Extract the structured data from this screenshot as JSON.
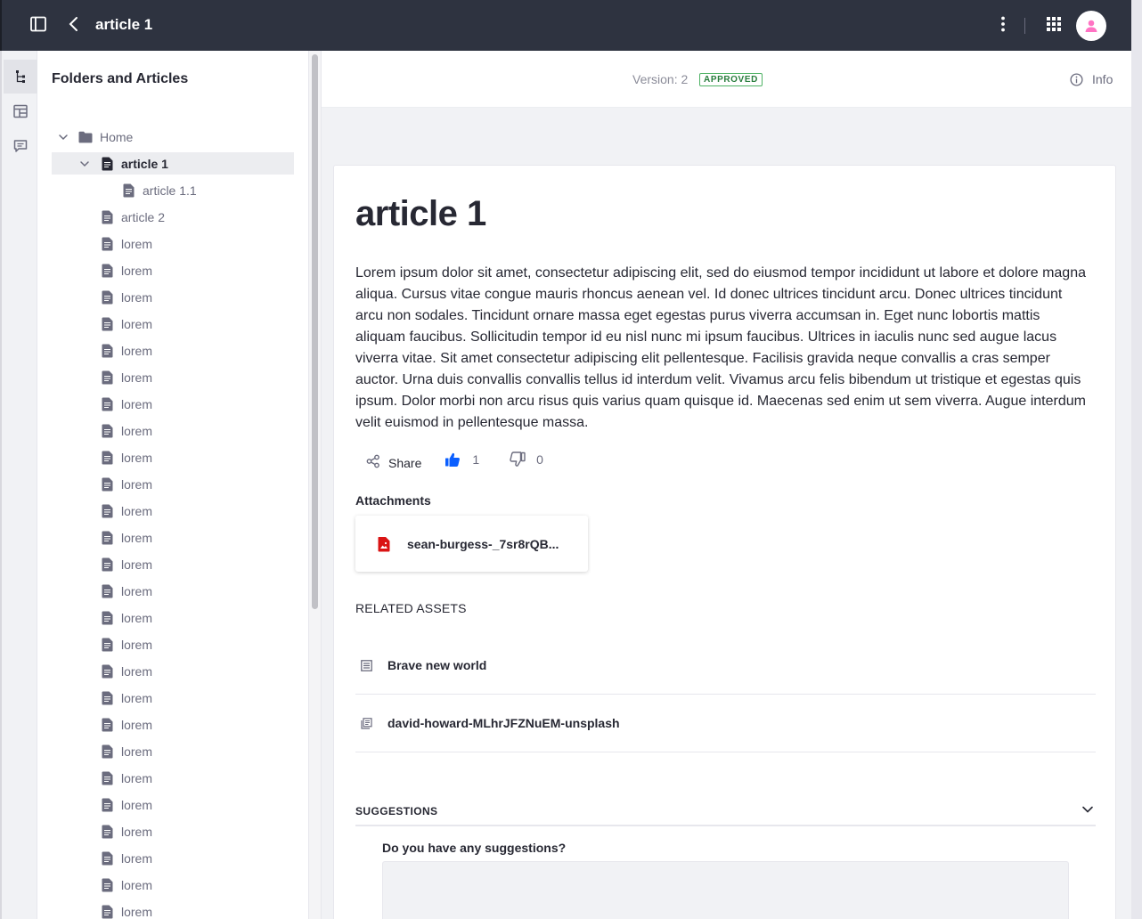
{
  "topbar": {
    "title": "article 1",
    "icons": [
      "sidebar-toggle-icon",
      "back-icon",
      "kebab-menu-icon",
      "apps-grid-icon",
      "user-avatar-icon"
    ]
  },
  "rail": {
    "items": [
      "tree-icon",
      "layout-icon",
      "comments-icon"
    ]
  },
  "tree": {
    "heading": "Folders and Articles",
    "rows": [
      {
        "label": "Home",
        "type": "folder",
        "level": 0,
        "expanded": true
      },
      {
        "label": "article 1",
        "type": "article",
        "level": 1,
        "expanded": true,
        "selected": true
      },
      {
        "label": "article 1.1",
        "type": "article",
        "level": 2
      },
      {
        "label": "article 2",
        "type": "article",
        "level": 1
      },
      {
        "label": "lorem",
        "type": "article",
        "level": 1
      },
      {
        "label": "lorem",
        "type": "article",
        "level": 1
      },
      {
        "label": "lorem",
        "type": "article",
        "level": 1
      },
      {
        "label": "lorem",
        "type": "article",
        "level": 1
      },
      {
        "label": "lorem",
        "type": "article",
        "level": 1
      },
      {
        "label": "lorem",
        "type": "article",
        "level": 1
      },
      {
        "label": "lorem",
        "type": "article",
        "level": 1
      },
      {
        "label": "lorem",
        "type": "article",
        "level": 1
      },
      {
        "label": "lorem",
        "type": "article",
        "level": 1
      },
      {
        "label": "lorem",
        "type": "article",
        "level": 1
      },
      {
        "label": "lorem",
        "type": "article",
        "level": 1
      },
      {
        "label": "lorem",
        "type": "article",
        "level": 1
      },
      {
        "label": "lorem",
        "type": "article",
        "level": 1
      },
      {
        "label": "lorem",
        "type": "article",
        "level": 1
      },
      {
        "label": "lorem",
        "type": "article",
        "level": 1
      },
      {
        "label": "lorem",
        "type": "article",
        "level": 1
      },
      {
        "label": "lorem",
        "type": "article",
        "level": 1
      },
      {
        "label": "lorem",
        "type": "article",
        "level": 1
      },
      {
        "label": "lorem",
        "type": "article",
        "level": 1
      },
      {
        "label": "lorem",
        "type": "article",
        "level": 1
      },
      {
        "label": "lorem",
        "type": "article",
        "level": 1
      },
      {
        "label": "lorem",
        "type": "article",
        "level": 1
      },
      {
        "label": "lorem",
        "type": "article",
        "level": 1
      },
      {
        "label": "lorem",
        "type": "article",
        "level": 1
      },
      {
        "label": "lorem",
        "type": "article",
        "level": 1
      },
      {
        "label": "lorem",
        "type": "article",
        "level": 1
      }
    ]
  },
  "main": {
    "version_label": "Version: 2",
    "status_badge": "APPROVED",
    "info_label": "Info",
    "article": {
      "title": "article 1",
      "body": "Lorem ipsum dolor sit amet, consectetur adipiscing elit, sed do eiusmod tempor incididunt ut labore et dolore magna aliqua. Cursus vitae congue mauris rhoncus aenean vel. Id donec ultrices tincidunt arcu. Donec ultrices tincidunt arcu non sodales. Tincidunt ornare massa eget egestas purus viverra accumsan in. Eget nunc lobortis mattis aliquam faucibus. Sollicitudin tempor id eu nisl nunc mi ipsum faucibus. Ultrices in iaculis nunc sed augue lacus viverra vitae. Sit amet consectetur adipiscing elit pellentesque. Facilisis gravida neque convallis a cras semper auctor. Urna duis convallis convallis tellus id interdum velit. Vivamus arcu felis bibendum ut tristique et egestas quis ipsum. Dolor morbi non arcu risus quis varius quam quisque id. Maecenas sed enim ut sem viverra. Augue interdum velit euismod in pellentesque massa.",
      "share_label": "Share",
      "likes": "1",
      "dislikes": "0",
      "attachments_label": "Attachments",
      "attachment_name": "sean-burgess-_7sr8rQB...",
      "related_label": "RELATED ASSETS",
      "related": [
        {
          "name": "Brave new world",
          "icon": "web-content-icon"
        },
        {
          "name": "david-howard-MLhrJFZNuEM-unsplash",
          "icon": "document-copy-icon"
        }
      ],
      "suggestions_label": "SUGGESTIONS",
      "suggestions_question": "Do you have any suggestions?"
    }
  },
  "colors": {
    "topbar": "#2e3340",
    "accent": "#0b5fff",
    "approved": "#287d3c",
    "attachment_icon": "#da1414",
    "avatar_icon": "#ff73c3"
  }
}
